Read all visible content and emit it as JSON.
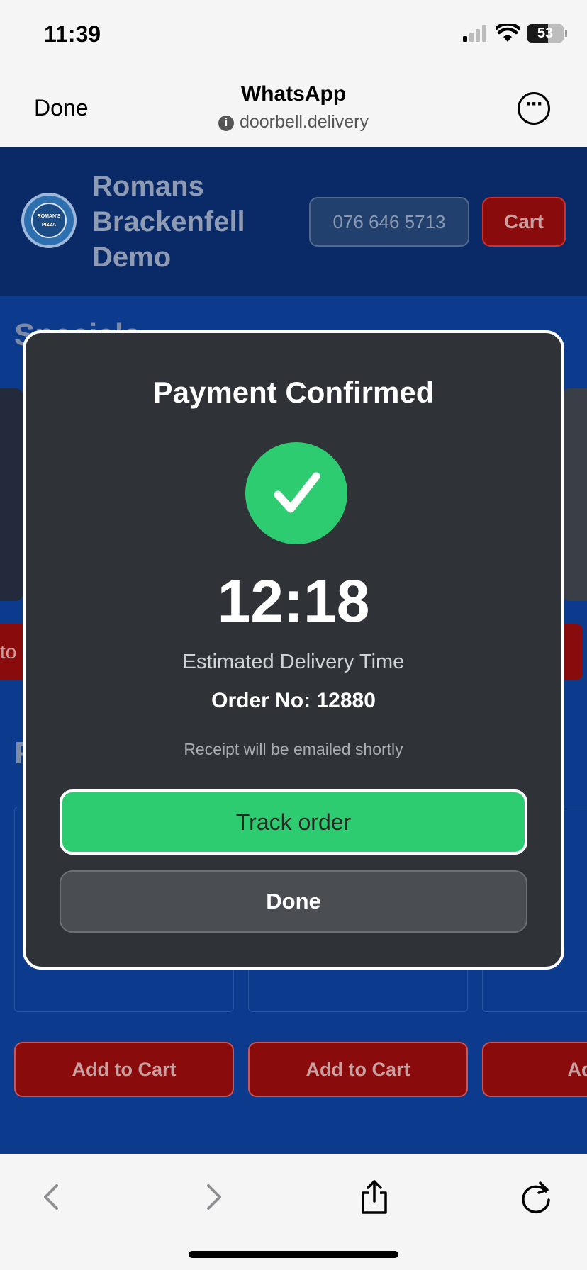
{
  "status_bar": {
    "time": "11:39",
    "battery": "53"
  },
  "browser": {
    "done_label": "Done",
    "title": "WhatsApp",
    "url": "doorbell.delivery",
    "info_icon": "i"
  },
  "site": {
    "name": "Romans Brackenfell Demo",
    "logo_text": "ROMAN'S PIZZA",
    "phone": "076 646 5713",
    "cart_label": "Cart",
    "section_specials": "Specials",
    "section_partial": "P",
    "partial_left_button": "to C",
    "add_to_cart": [
      "Add to Cart",
      "Add to Cart",
      "Add t"
    ]
  },
  "modal": {
    "title": "Payment Confirmed",
    "time": "12:18",
    "estimated_label": "Estimated Delivery Time",
    "order_label": "Order No: 12880",
    "receipt_note": "Receipt will be emailed shortly",
    "track_button": "Track order",
    "done_button": "Done"
  },
  "colors": {
    "site_bg": "#0c3a8c",
    "header_bg": "#092a66",
    "modal_bg": "#2f3337",
    "success": "#2ecc71",
    "cart_red": "#8a0b0b"
  },
  "icons": [
    "signal-icon",
    "wifi-icon",
    "battery-icon",
    "info-icon",
    "more-icon",
    "checkmark-icon",
    "back-icon",
    "forward-icon",
    "share-icon",
    "reload-icon"
  ]
}
